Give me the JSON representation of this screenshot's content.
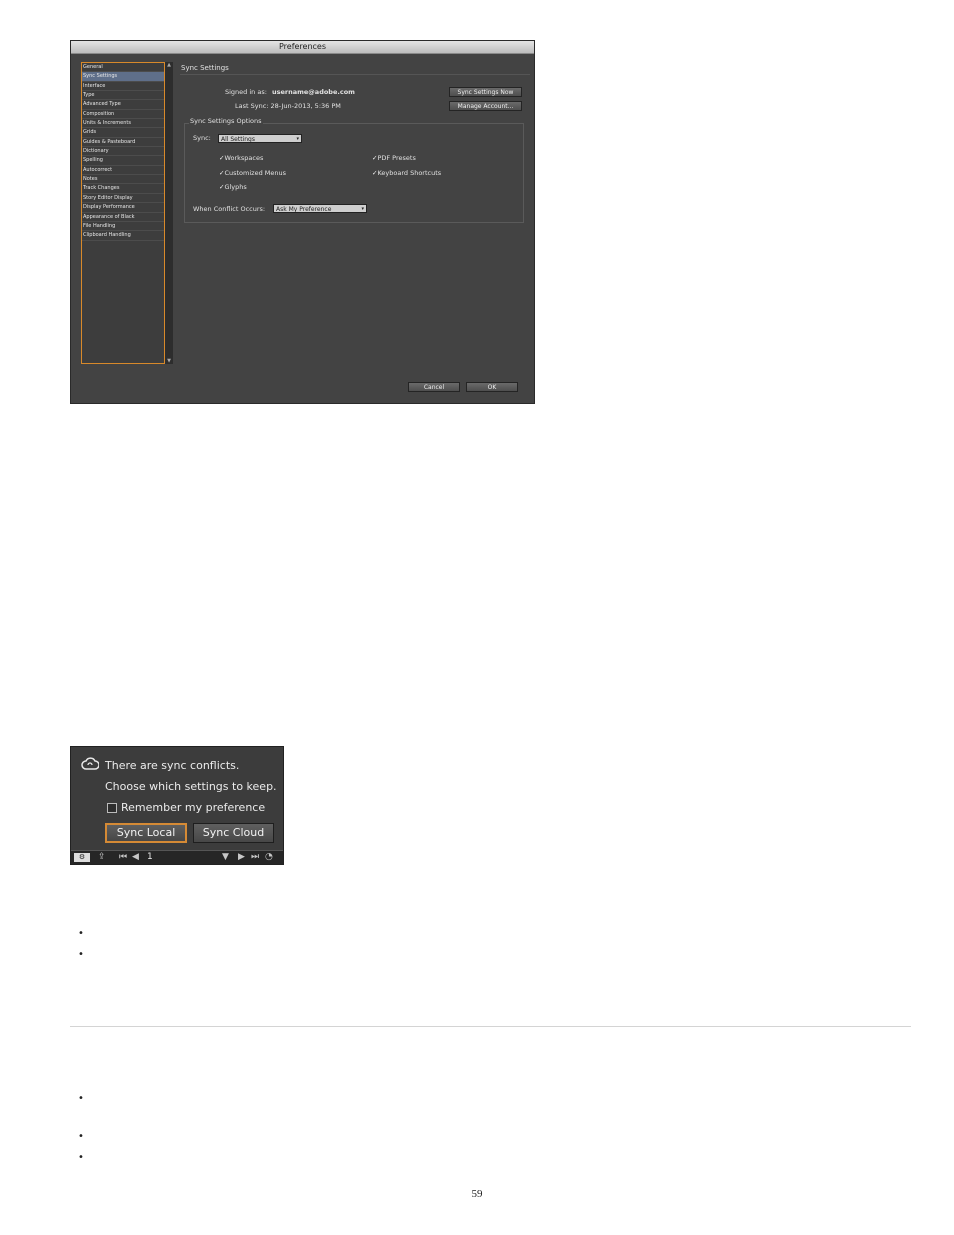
{
  "preferences": {
    "title": "Preferences",
    "sidebar_items": [
      "General",
      "Sync Settings",
      "Interface",
      "Type",
      "Advanced Type",
      "Composition",
      "Units & Increments",
      "Grids",
      "Guides & Pasteboard",
      "Dictionary",
      "Spelling",
      "Autocorrect",
      "Notes",
      "Track Changes",
      "Story Editor Display",
      "Display Performance",
      "Appearance of Black",
      "File Handling",
      "Clipboard Handling"
    ],
    "selected_index": 1,
    "section_title": "Sync Settings",
    "signed_in_label": "Signed in as:",
    "signed_in_value": "username@adobe.com",
    "last_sync": "Last Sync: 28-Jun-2013, 5:36 PM",
    "sync_now_button": "Sync Settings Now",
    "manage_account_button": "Manage Account...",
    "options_group": "Sync Settings Options",
    "sync_label": "Sync:",
    "sync_value": "All Settings",
    "checkboxes": {
      "workspaces": "Workspaces",
      "pdf_presets": "PDF Presets",
      "customized_menus": "Customized Menus",
      "keyboard_shortcuts": "Keyboard Shortcuts",
      "glyphs": "Glyphs"
    },
    "conflict_label": "When Conflict Occurs:",
    "conflict_value": "Ask My Preference",
    "cancel_button": "Cancel",
    "ok_button": "OK",
    "check_glyph": "✓",
    "dropdown_arrow": "▾"
  },
  "conflict_panel": {
    "line1": "There are sync conflicts.",
    "line2": "Choose which settings to keep.",
    "remember": "Remember my preference",
    "sync_local": "Sync Local",
    "sync_cloud": "Sync Cloud",
    "page_number": "1"
  },
  "page": {
    "bullet_glyph": "•",
    "page_number": "59"
  },
  "colors": {
    "accent_orange": "#d58a35",
    "panel_gray": "#434343",
    "selected_blue": "#5f6f8a"
  }
}
